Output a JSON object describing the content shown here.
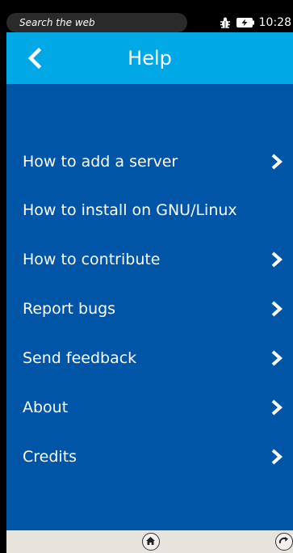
{
  "status_bar": {
    "search_placeholder": "Search the web",
    "time": "10:28",
    "icons": [
      "bug-icon",
      "battery-charging-icon"
    ]
  },
  "header": {
    "title": "Help",
    "back_icon": "chevron-left-icon"
  },
  "menu": {
    "items": [
      {
        "label": "How to add a server",
        "has_chevron": true
      },
      {
        "label": "How to install on GNU/Linux",
        "has_chevron": false
      },
      {
        "label": "How to contribute",
        "has_chevron": true
      },
      {
        "label": "Report bugs",
        "has_chevron": true
      },
      {
        "label": "Send feedback",
        "has_chevron": true
      },
      {
        "label": "About",
        "has_chevron": true
      },
      {
        "label": "Credits",
        "has_chevron": true
      }
    ]
  },
  "bottom_bar": {
    "icons": [
      "home-icon",
      "refresh-icon"
    ]
  },
  "colors": {
    "background": "#0055a6",
    "header": "#00a9e6",
    "status_bar": "#000000",
    "bottom_bar": "#e7e3dd",
    "text": "#ffffff"
  }
}
